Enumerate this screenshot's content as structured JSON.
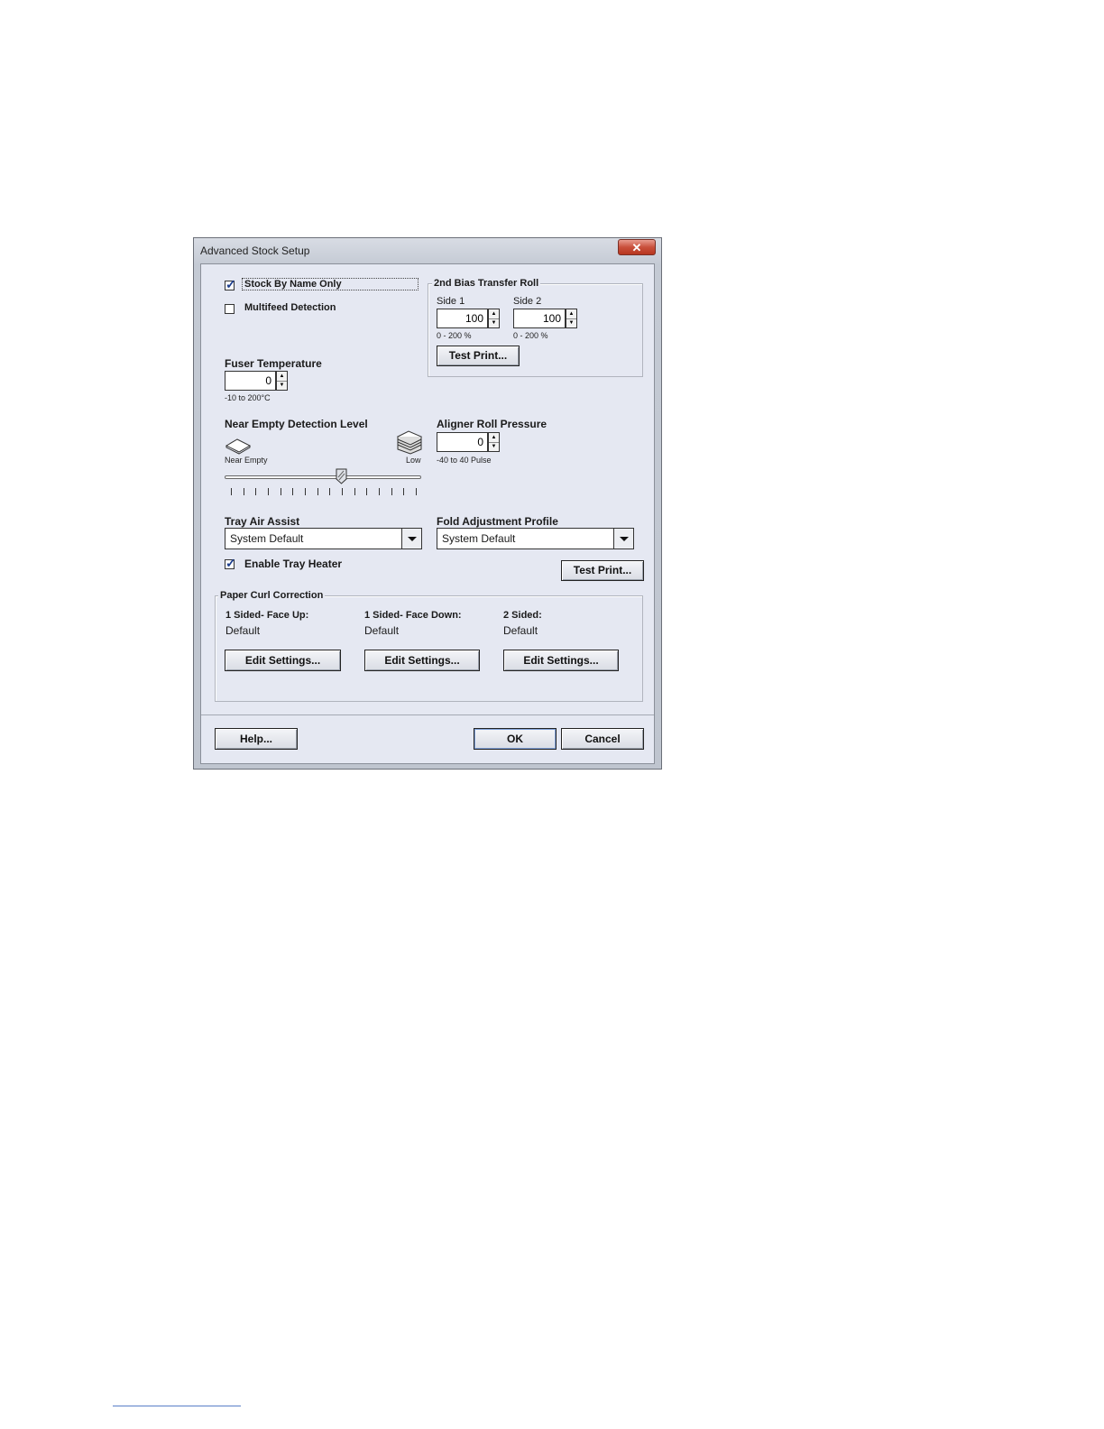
{
  "window": {
    "title": "Advanced Stock Setup",
    "close_glyph": "✕"
  },
  "stock_by_name_only": {
    "label": "Stock By Name Only",
    "checked": true
  },
  "multifeed_detection": {
    "label": "Multifeed Detection",
    "checked": false
  },
  "bias_transfer_roll": {
    "title": "2nd Bias Transfer Roll",
    "side1": {
      "label": "Side 1",
      "value": "100",
      "range": "0 - 200 %"
    },
    "side2": {
      "label": "Side 2",
      "value": "100",
      "range": "0 - 200 %"
    },
    "test_print_label": "Test Print..."
  },
  "fuser_temperature": {
    "label": "Fuser Temperature",
    "value": "0",
    "range": "-10 to 200°C"
  },
  "near_empty": {
    "label": "Near Empty Detection Level",
    "left_caption": "Near Empty",
    "right_caption": "Low",
    "slider_fraction": 0.6
  },
  "aligner_roll_pressure": {
    "label": "Aligner Roll Pressure",
    "value": "0",
    "range": "-40 to 40 Pulse"
  },
  "tray_air_assist": {
    "label": "Tray Air Assist",
    "value": "System Default"
  },
  "fold_adjustment_profile": {
    "label": "Fold Adjustment Profile",
    "value": "System Default"
  },
  "enable_tray_heater": {
    "label": "Enable Tray Heater",
    "checked": true
  },
  "fold_test_print_label": "Test Print...",
  "paper_curl": {
    "title": "Paper Curl Correction",
    "columns": [
      {
        "heading": "1 Sided- Face Up:",
        "value": "Default",
        "button": "Edit Settings..."
      },
      {
        "heading": "1 Sided- Face Down:",
        "value": "Default",
        "button": "Edit Settings..."
      },
      {
        "heading": "2 Sided:",
        "value": "Default",
        "button": "Edit Settings..."
      }
    ]
  },
  "footer": {
    "help_label": "Help...",
    "ok_label": "OK",
    "cancel_label": "Cancel"
  },
  "icons": {
    "check": "checkmark-icon",
    "spin_up": "▲",
    "spin_down": "▼",
    "dropdown": "▼"
  }
}
